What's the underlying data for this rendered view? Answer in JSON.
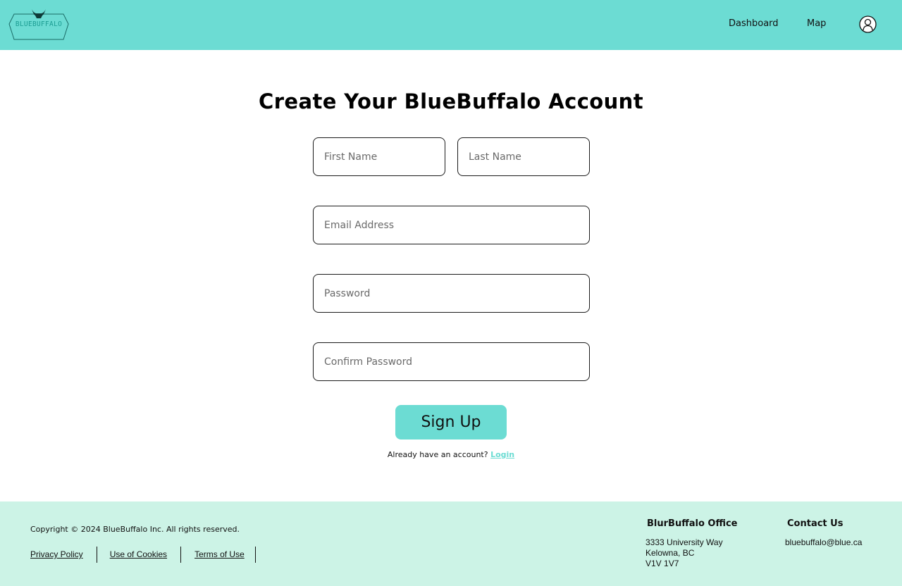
{
  "brand": {
    "logo_text": "BLUEBUFFALO",
    "accent_color": "#6cdcd3",
    "footer_color": "#ccf3e6",
    "logo_icon": "buffalo-head-icon"
  },
  "nav": {
    "dashboard": "Dashboard",
    "map": "Map",
    "profile_icon": "user-profile-icon"
  },
  "form": {
    "title": "Create Your BlueBuffalo Account",
    "first_name_placeholder": "First Name",
    "last_name_placeholder": "Last Name",
    "email_placeholder": "Email Address",
    "password_placeholder": "Password",
    "confirm_placeholder": "Confirm Password",
    "submit": "Sign Up",
    "already_text": "Already have an account?",
    "login_link": "Login"
  },
  "footer": {
    "copyright": "Copyright © 2024 BlueBuffalo Inc. All rights reserved.",
    "links": [
      "Privacy Policy",
      "Use of Cookies",
      "Terms of Use"
    ],
    "office_title": "BlurBuffalo Office",
    "office_lines": [
      "3333 University Way",
      "Kelowna, BC",
      "V1V 1V7"
    ],
    "contact_title": "Contact Us",
    "contact_email": "bluebuffalo@blue.ca"
  }
}
